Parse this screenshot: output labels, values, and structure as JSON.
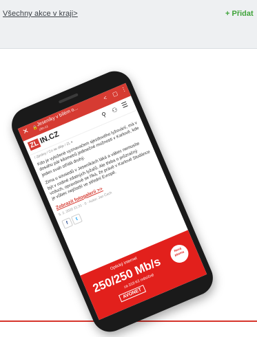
{
  "header": {
    "all_events_link": "Všechny akce v kraji>",
    "add_link": "+ Přidat"
  },
  "phone": {
    "browser": {
      "title": "Jeseníky v bílém o...",
      "domain": "zlin.cz"
    },
    "site": {
      "logo_red": "ZL",
      "logo_rest": "IN.CZ",
      "breadcrumb": "/ Zprávy / Co se děje / ZL ▾",
      "paragraph_1": "Kdo je vyložené vyznavačem sjezdového lyžování, má v dosahu pár kilometrů jedinečné možnosti v Karlově, kde jeden svah střídá druhý.",
      "paragraph_2": "Zima u sousedů v Jeseníkách láká a vábec nemusíte být v rodině zdatných lyžařů. Ale třeba o průzračný vzduch, opravdové se říká, že právě v Karlově Studánce je vůbec nejčistší ve střední Evropě.",
      "photo_link": "Zobrazit fotogalerii >>",
      "meta": "5. 2. 2020 21:31 · 0 · Autor: Jan Čech",
      "social": [
        "f",
        "t"
      ]
    },
    "ad": {
      "line1": "Optický internet",
      "speed": "250/250 Mb/s",
      "price": "za 319 Kč měsíčně",
      "brand": "AVONET",
      "badge": "Nová pásma"
    }
  }
}
